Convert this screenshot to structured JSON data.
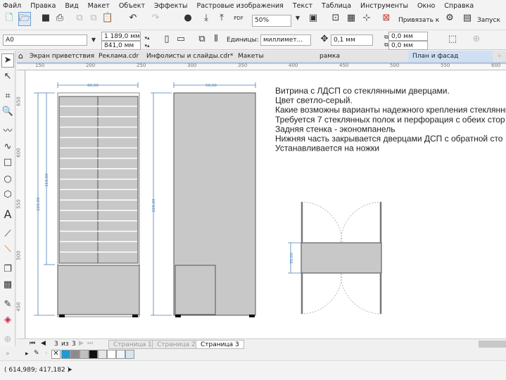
{
  "menu": [
    "Файл",
    "Правка",
    "Вид",
    "Макет",
    "Объект",
    "Эффекты",
    "Растровые изображения",
    "Текст",
    "Таблица",
    "Инструменты",
    "Окно",
    "Справка"
  ],
  "toolbar": {
    "zoom": "50%",
    "snap": "Привязать к",
    "launch": "Запуск"
  },
  "propbar": {
    "page_size": "A0",
    "width": "1 189,0 мм",
    "height": "841,0 мм",
    "units_label": "Единицы:",
    "units": "миллимет...",
    "nudge": "0,1 мм",
    "dup_x": "0,0 мм",
    "dup_y": "0,0 мм"
  },
  "tabs": [
    {
      "label": "Экран приветствия"
    },
    {
      "label": "Реклама.cdr"
    },
    {
      "label": "Инфолисты и слайды.cdr*"
    },
    {
      "label": "Макеты"
    },
    {
      "label": "рамка"
    },
    {
      "label": "План и фасад",
      "active": true
    }
  ],
  "rulers": {
    "h": [
      "150",
      "200",
      "250",
      "300",
      "350",
      "400",
      "450",
      "500",
      "550",
      "600"
    ],
    "v": [
      "650",
      "600",
      "550",
      "500",
      "450"
    ]
  },
  "drawing": {
    "front_width": "80,00",
    "front_height": "220,00",
    "glass_height": "110,00",
    "side_width": "50,00",
    "side_height": "220,00",
    "plan_depth": "30,00"
  },
  "notes": [
    "Витрина с ЛДСП со стеклянными дверцами.",
    "Цвет светло-серый.",
    "Какие возможны варианты надежного крепления стеклянны",
    "Требуется 7 стеклянных полок и перфорация с обеих стор",
    "Задняя стенка - экономпанель",
    "Нижняя часть закрывается дверцами ДСП с обратной сто",
    "Устанавливается на ножки"
  ],
  "pagenav": {
    "current": "3",
    "of": "из",
    "total": "3",
    "pages": [
      "Страница 1",
      "Страница 2",
      "Страница 3"
    ]
  },
  "palette": [
    "#1e9ad6",
    "#8c8c8c",
    "#c0c0c0",
    "#111111",
    "#e6e6e6",
    "#ffffff",
    "#eef6f8",
    "#d4e6ee"
  ],
  "status": {
    "coords": "( 614,989; 417,182 )"
  }
}
